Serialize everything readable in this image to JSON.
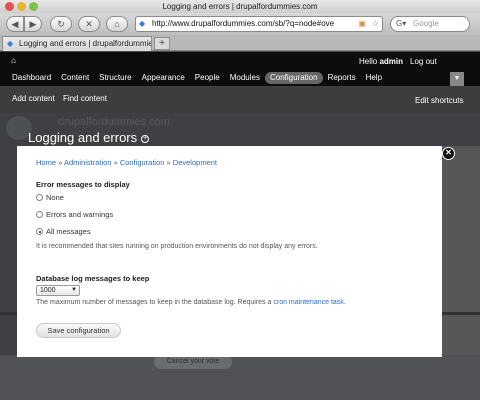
{
  "browser": {
    "window_title": "Logging and errors | drupalfordummies.com",
    "url": "http://www.drupalfordummies.com/sb/?q=node#ove",
    "search_placeholder": "Google",
    "tab_label": "Logging and errors | drupalfordummies.com",
    "new_tab": "+"
  },
  "toolbar": {
    "home_icon": "⌂",
    "hello_prefix": "Hello ",
    "hello_user": "admin",
    "logout": "Log out",
    "menu": [
      {
        "label": "Dashboard"
      },
      {
        "label": "Content"
      },
      {
        "label": "Structure"
      },
      {
        "label": "Appearance"
      },
      {
        "label": "People"
      },
      {
        "label": "Modules"
      },
      {
        "label": "Configuration"
      },
      {
        "label": "Reports"
      },
      {
        "label": "Help"
      }
    ],
    "active_index": 6
  },
  "shortcuts": {
    "add_content": "Add content",
    "find_content": "Find content",
    "edit_shortcuts": "Edit shortcuts"
  },
  "background": {
    "site_name": "drupalfordummies.com",
    "page_title": "Logging and errors",
    "vote_button": "Cancel your vote"
  },
  "overlay": {
    "breadcrumb": [
      "Home",
      "Administration",
      "Configuration",
      "Development"
    ],
    "breadcrumb_sep": " » ",
    "error_heading": "Error messages to display",
    "options": [
      {
        "label": "None",
        "checked": false
      },
      {
        "label": "Errors and warnings",
        "checked": false
      },
      {
        "label": "All messages",
        "checked": true
      }
    ],
    "error_desc": "It is recommended that sites running on production environments do not display any errors.",
    "log_heading": "Database log messages to keep",
    "log_value": "1000",
    "log_desc_prefix": "The maximum number of messages to keep in the database log. Requires a ",
    "log_desc_link": "cron maintenance task",
    "log_desc_suffix": ".",
    "save_button": "Save configuration",
    "close_icon": "close-icon"
  }
}
